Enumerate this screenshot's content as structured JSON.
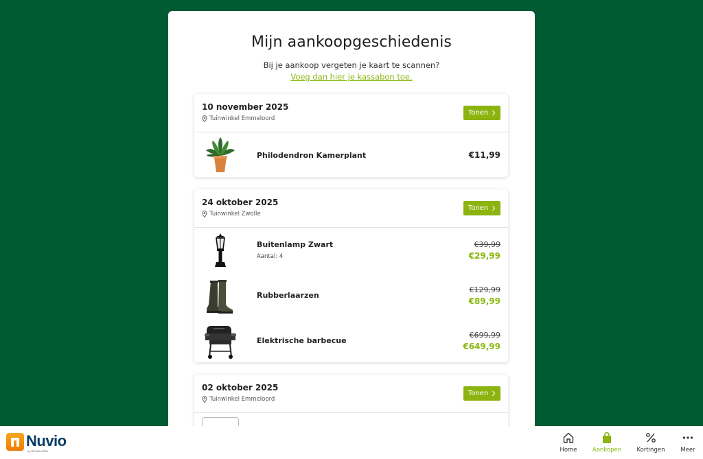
{
  "page": {
    "title": "Mijn aankoopgeschiedenis",
    "subtitle": "Bij je aankoop vergeten je kaart te scannen?",
    "receipt_link": "Voeg dan hier je kassabon toe."
  },
  "purchases": [
    {
      "date": "10 november 2025",
      "store": "Tuinwinkel Emmeloord",
      "show_label": "Tonen",
      "items": [
        {
          "name": "Philodendron Kamerplant",
          "price": "€11,99",
          "icon": "plant-icon"
        }
      ]
    },
    {
      "date": "24 oktober 2025",
      "store": "Tuinwinkel Zwolle",
      "show_label": "Tonen",
      "items": [
        {
          "name": "Buitenlamp Zwart",
          "quantity": "Aantal: 4",
          "old_price": "€39,99",
          "new_price": "€29,99",
          "icon": "lamp-icon"
        },
        {
          "name": "Rubberlaarzen",
          "old_price": "€129,99",
          "new_price": "€89,99",
          "icon": "boots-icon"
        },
        {
          "name": "Elektrische barbecue",
          "old_price": "€699,99",
          "new_price": "€649,99",
          "icon": "barbecue-icon"
        }
      ]
    },
    {
      "date": "02 oktober 2025",
      "store": "Tuinwinkel Emmeloord",
      "show_label": "Tonen",
      "items": []
    }
  ],
  "bottom_bar": {
    "logo": "Nuvio",
    "logo_sub": "by RETAILVISTA",
    "nav": [
      {
        "label": "Home",
        "icon": "home-icon"
      },
      {
        "label": "Aankopen",
        "icon": "shopping-bag-icon",
        "active": true
      },
      {
        "label": "Kortingen",
        "icon": "percent-icon"
      },
      {
        "label": "Meer",
        "icon": "more-icon"
      }
    ]
  },
  "colors": {
    "background": "#005a32",
    "accent": "#8cb411",
    "sale_price": "#8ab70f",
    "logo_orange": "#f39200",
    "logo_blue": "#0b3d66"
  }
}
